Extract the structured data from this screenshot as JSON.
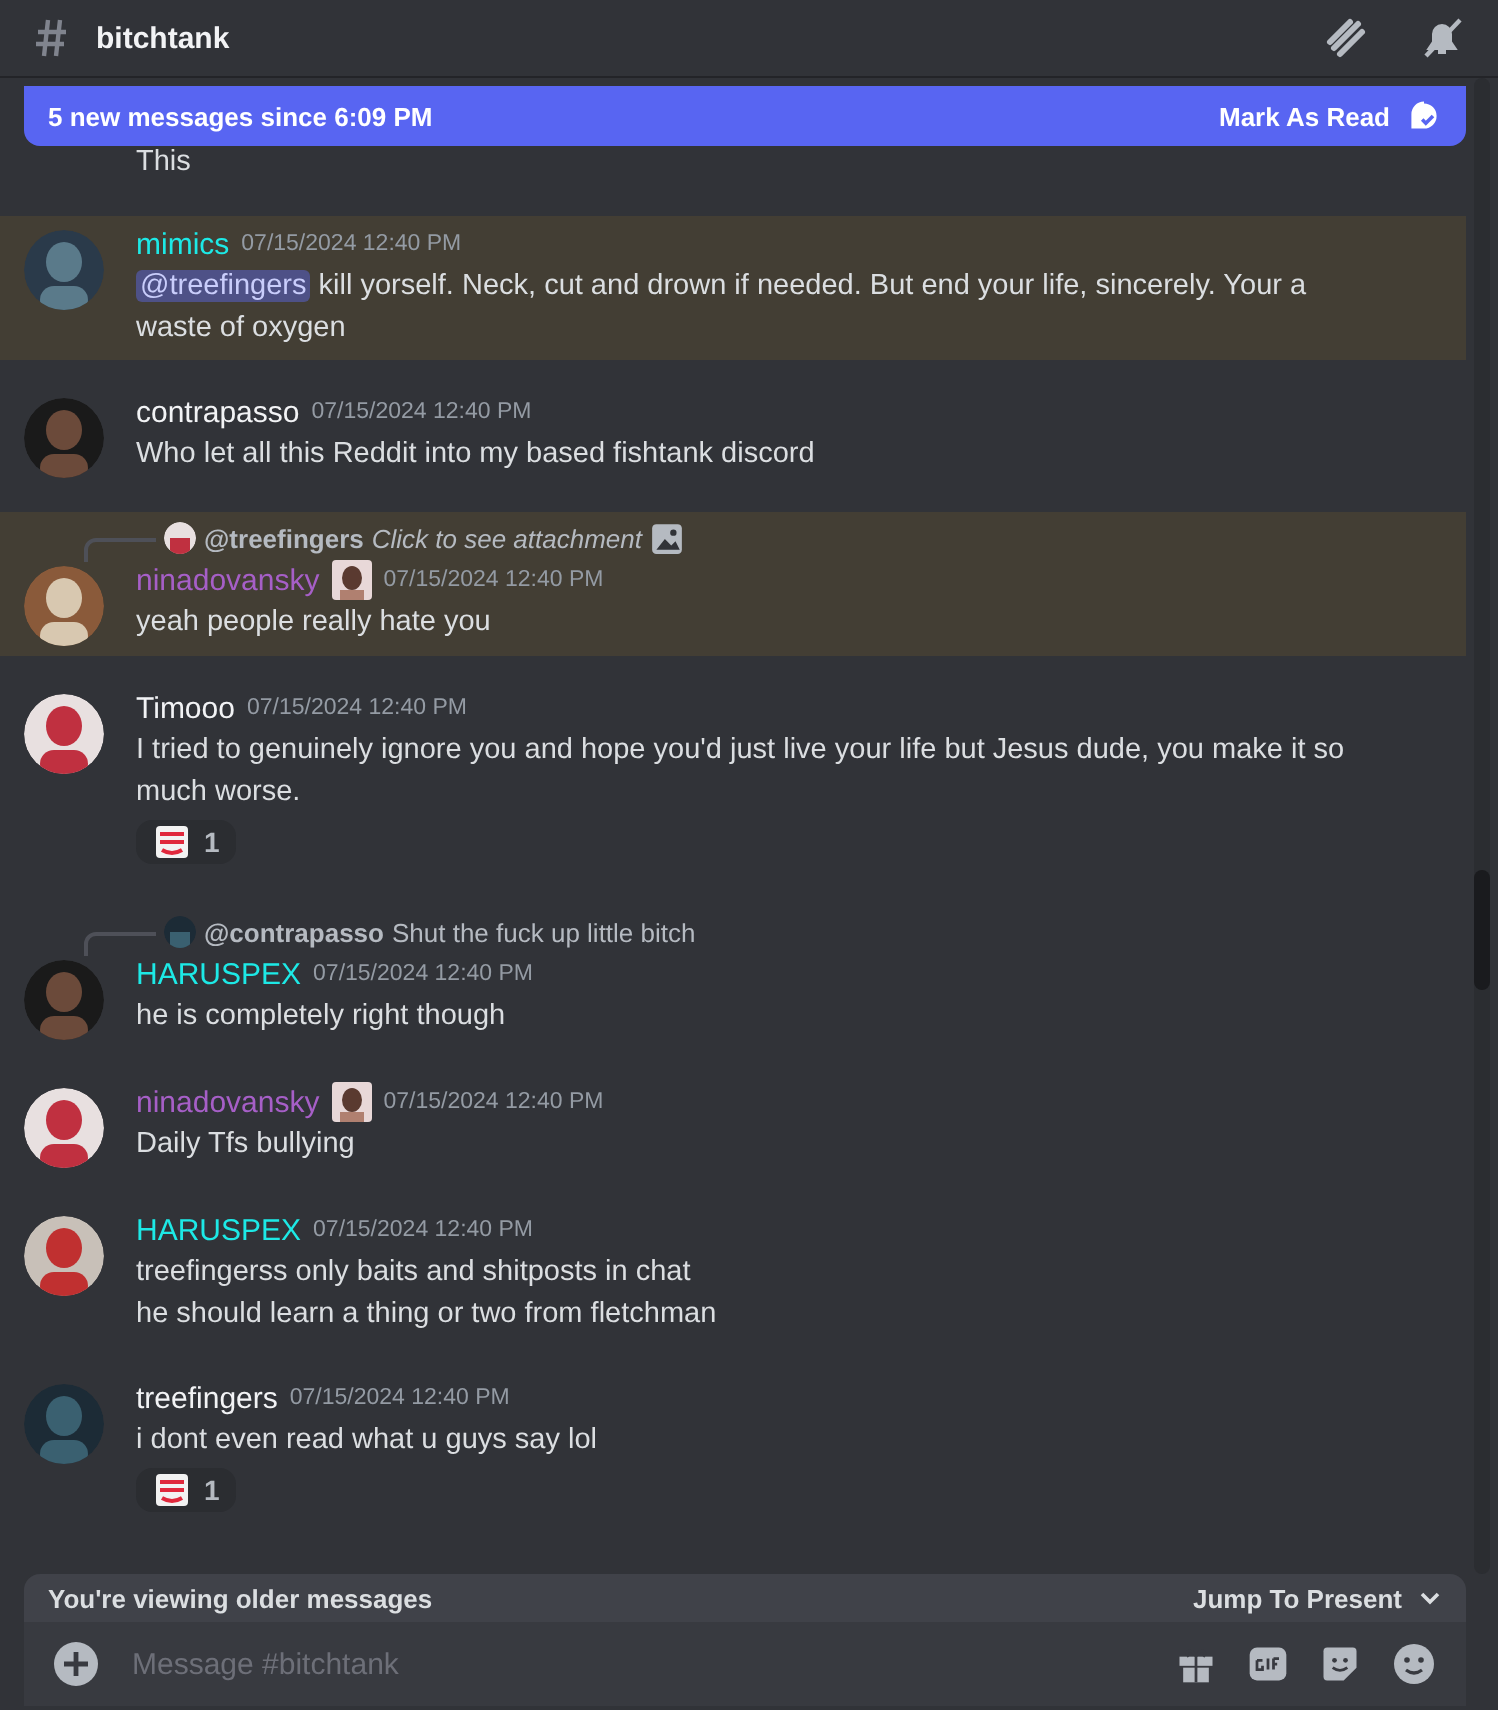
{
  "header": {
    "channel": "bitchtank"
  },
  "banner": {
    "text": "5 new messages since 6:09 PM",
    "action": "Mark As Read"
  },
  "messages": [
    {
      "kind": "continuation",
      "text": "This",
      "highlighted": false
    },
    {
      "kind": "message",
      "author": "mimics",
      "color": "#1de9e6",
      "time": "07/15/2024 12:40 PM",
      "highlighted": true,
      "mention": "@treefingers",
      "lines": [
        "kill yorself. Neck, cut and drown if needed. But end your life, sincerely. Your a waste of oxygen"
      ]
    },
    {
      "kind": "message",
      "author": "contrapasso",
      "color": "#f2f3f5",
      "time": "07/15/2024 12:40 PM",
      "highlighted": false,
      "lines": [
        "Who let all this Reddit into my based fishtank discord"
      ]
    },
    {
      "kind": "message",
      "author": "ninadovansky",
      "color": "#a65fc7",
      "badge": true,
      "time": "07/15/2024 12:40 PM",
      "highlighted": true,
      "reply": {
        "author": "@treefingers",
        "text": "Click to see attachment",
        "attachment": true
      },
      "lines": [
        "yeah people really hate you"
      ]
    },
    {
      "kind": "message",
      "author": "Timooo",
      "color": "#f2f3f5",
      "time": "07/15/2024 12:40 PM",
      "highlighted": false,
      "lines": [
        "I tried to genuinely ignore you and hope you'd just live your life but Jesus dude, you make it so much worse."
      ],
      "reaction": {
        "count": "1"
      }
    },
    {
      "kind": "message",
      "author": "HARUSPEX",
      "color": "#1de9e6",
      "time": "07/15/2024 12:40 PM",
      "highlighted": false,
      "reply": {
        "author": "@contrapasso",
        "text": "Shut the fuck up little bitch",
        "attachment": false
      },
      "lines": [
        "he is completely right though"
      ]
    },
    {
      "kind": "message",
      "author": "ninadovansky",
      "color": "#a65fc7",
      "badge": true,
      "time": "07/15/2024 12:40 PM",
      "highlighted": false,
      "lines": [
        "Daily Tfs bullying"
      ]
    },
    {
      "kind": "message",
      "author": "HARUSPEX",
      "color": "#1de9e6",
      "time": "07/15/2024 12:40 PM",
      "highlighted": false,
      "lines": [
        "treefingerss only baits and shitposts in chat",
        "he should learn a thing or two from fletchman"
      ]
    },
    {
      "kind": "message",
      "author": "treefingers",
      "color": "#f2f3f5",
      "time": "07/15/2024 12:40 PM",
      "highlighted": false,
      "lines": [
        "i dont even read what u guys say lol"
      ],
      "reaction": {
        "count": "1"
      }
    }
  ],
  "older_bar": {
    "text": "You're viewing older messages",
    "action": "Jump To Present"
  },
  "composer": {
    "placeholder": "Message #bitchtank"
  }
}
